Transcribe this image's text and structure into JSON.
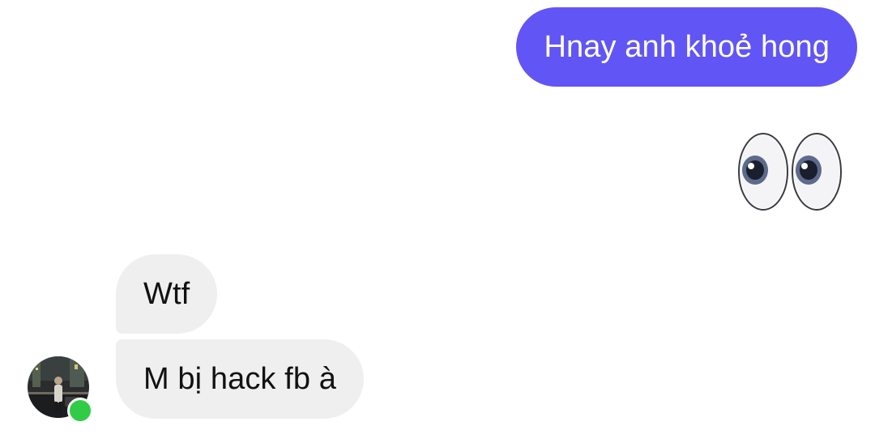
{
  "messages": {
    "outgoing": {
      "text": "Hnay anh khoẻ hong"
    },
    "reaction": {
      "emoji_name": "eyes-emoji",
      "glyph": "👀"
    },
    "incoming": [
      {
        "text": "Wtf"
      },
      {
        "text": "M bị hack fb à"
      }
    ]
  },
  "contact": {
    "avatar_icon": "contact-avatar",
    "status": "online"
  },
  "colors": {
    "outgoing_bubble": "#6155F5",
    "incoming_bubble": "#EFEFEF",
    "online_indicator": "#31CC46",
    "background": "#FFFFFF"
  }
}
